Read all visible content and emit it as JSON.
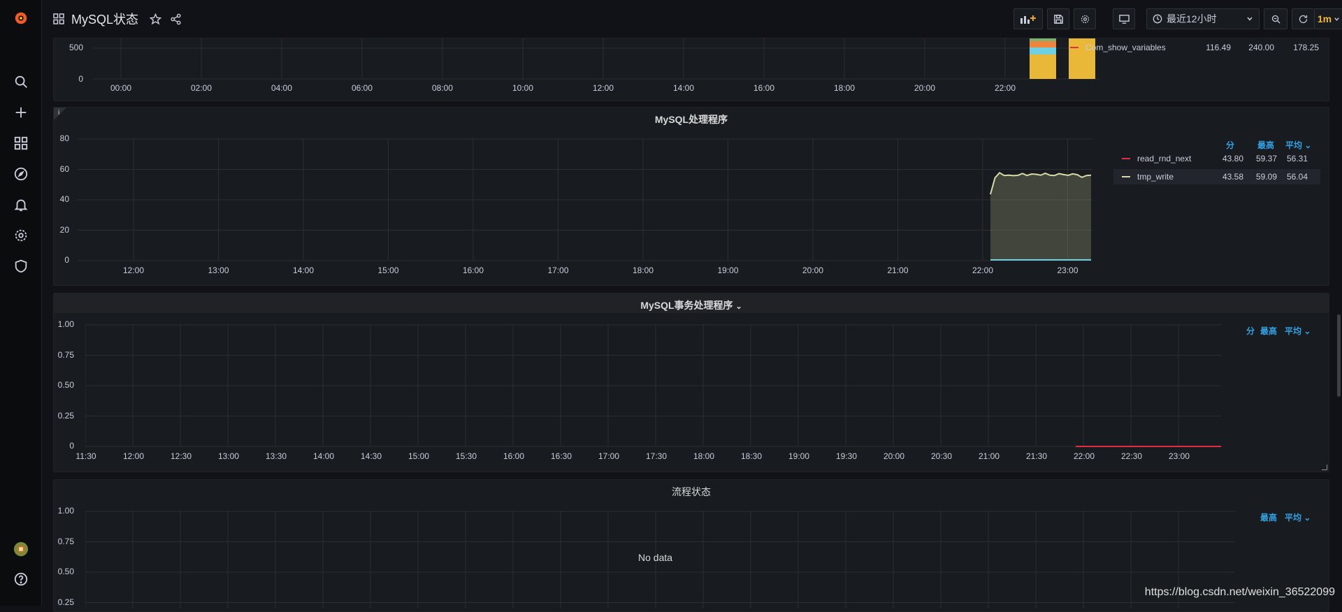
{
  "app": {
    "title": "MySQL状态"
  },
  "topbar": {
    "time_range": "最近12小时",
    "refresh": "1m"
  },
  "panels": {
    "top": {
      "y_ticks": [
        "500",
        "0"
      ],
      "x_ticks": [
        "00:00",
        "02:00",
        "04:00",
        "06:00",
        "08:00",
        "10:00",
        "12:00",
        "14:00",
        "16:00",
        "18:00",
        "20:00",
        "22:00"
      ],
      "legend": [
        {
          "name": "Com_show_variables",
          "min": "116.49",
          "max": "240.00",
          "avg": "178.25",
          "color": "#e02f44"
        }
      ]
    },
    "handlers": {
      "title": "MySQL处理程序",
      "y_ticks": [
        "80",
        "60",
        "40",
        "20",
        "0"
      ],
      "x_ticks": [
        "12:00",
        "13:00",
        "14:00",
        "15:00",
        "16:00",
        "17:00",
        "18:00",
        "19:00",
        "20:00",
        "21:00",
        "22:00",
        "23:00"
      ],
      "legend_headers": {
        "min": "分",
        "max": "最高",
        "avg": "平均"
      },
      "legend": [
        {
          "name": "read_rnd_next",
          "min": "43.80",
          "max": "59.37",
          "avg": "56.31",
          "color": "#e02f44"
        },
        {
          "name": "tmp_write",
          "min": "43.58",
          "max": "59.09",
          "avg": "56.04",
          "color": "#d8d9a6"
        }
      ]
    },
    "transactions": {
      "title": "MySQL事务处理程序",
      "y_ticks": [
        "1.00",
        "0.75",
        "0.50",
        "0.25",
        "0"
      ],
      "x_ticks": [
        "11:30",
        "12:00",
        "12:30",
        "13:00",
        "13:30",
        "14:00",
        "14:30",
        "15:00",
        "15:30",
        "16:00",
        "16:30",
        "17:00",
        "17:30",
        "18:00",
        "18:30",
        "19:00",
        "19:30",
        "20:00",
        "20:30",
        "21:00",
        "21:30",
        "22:00",
        "22:30",
        "23:00"
      ],
      "legend_headers": {
        "min": "分",
        "max": "最高",
        "avg": "平均"
      }
    },
    "process": {
      "title": "流程状态",
      "y_ticks": [
        "1.00",
        "0.75",
        "0.50",
        "0.25"
      ],
      "no_data": "No data",
      "legend_headers": {
        "max": "最高",
        "avg": "平均"
      }
    }
  },
  "watermark": "https://blog.csdn.net/weixin_36522099"
}
